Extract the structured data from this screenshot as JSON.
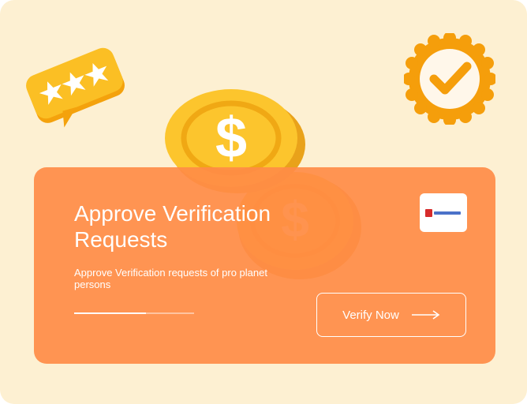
{
  "card": {
    "title": "Approve Verification Requests",
    "description": "Approve Verification requests of pro planet persons",
    "progress_fraction": 0.6,
    "cta_label": "Verify Now"
  },
  "icons": {
    "rating": "rating-stars-icon",
    "coin": "dollar-coin-icon",
    "badge": "checkmark-badge-icon",
    "logo": "brand-logo-icon",
    "arrow": "arrow-right-icon"
  },
  "colors": {
    "background": "#fdf0d2",
    "card": "#ff8c46",
    "coin": "#fbbf24",
    "badge": "#f59e0b"
  }
}
